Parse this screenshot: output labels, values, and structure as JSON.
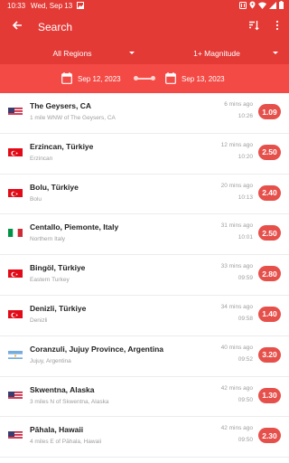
{
  "status_bar": {
    "time": "10:33",
    "date": "Wed, Sep 13",
    "icons": [
      "image-icon",
      "nfc-icon",
      "location-icon",
      "wifi-icon",
      "signal-icon",
      "battery-icon"
    ]
  },
  "app_bar": {
    "title": "Search",
    "back_icon": "arrow-left-icon",
    "actions": [
      "sort-icon",
      "more-vert-icon"
    ]
  },
  "filters": {
    "region": "All Regions",
    "magnitude": "1+ Magnitude"
  },
  "date_range": {
    "start": "Sep 12, 2023",
    "end": "Sep 13, 2023"
  },
  "colors": {
    "primary": "#e33a36",
    "date_bar": "#f44a45",
    "badge": "#e6504b"
  },
  "earthquakes": [
    {
      "place": "The Geysers, CA",
      "detail": "1 mile WNW of The Geysers, CA",
      "ago": "6 mins ago",
      "time": "10:26",
      "magnitude": "1.09",
      "flag": "us"
    },
    {
      "place": "Erzincan, Türkiye",
      "detail": "Erzincan",
      "ago": "12 mins ago",
      "time": "10:20",
      "magnitude": "2.50",
      "flag": "tr"
    },
    {
      "place": "Bolu, Türkiye",
      "detail": "Bolu",
      "ago": "20 mins ago",
      "time": "10:13",
      "magnitude": "2.40",
      "flag": "tr"
    },
    {
      "place": "Centallo, Piemonte, Italy",
      "detail": "Northern Italy",
      "ago": "31 mins ago",
      "time": "10:01",
      "magnitude": "2.50",
      "flag": "it"
    },
    {
      "place": "Bingöl, Türkiye",
      "detail": "Eastern Turkey",
      "ago": "33 mins ago",
      "time": "09:59",
      "magnitude": "2.80",
      "flag": "tr"
    },
    {
      "place": "Denizli, Türkiye",
      "detail": "Denizli",
      "ago": "34 mins ago",
      "time": "09:58",
      "magnitude": "1.40",
      "flag": "tr"
    },
    {
      "place": "Coranzuli, Jujuy Province, Argentina",
      "detail": "Jujuy, Argentina",
      "ago": "40 mins ago",
      "time": "09:52",
      "magnitude": "3.20",
      "flag": "ar"
    },
    {
      "place": "Skwentna, Alaska",
      "detail": "3 miles N of Skwentna, Alaska",
      "ago": "42 mins ago",
      "time": "09:50",
      "magnitude": "1.30",
      "flag": "us"
    },
    {
      "place": "Pāhala, Hawaii",
      "detail": "4 miles E of Pāhala, Hawaii",
      "ago": "42 mins ago",
      "time": "09:50",
      "magnitude": "2.30",
      "flag": "us"
    }
  ]
}
